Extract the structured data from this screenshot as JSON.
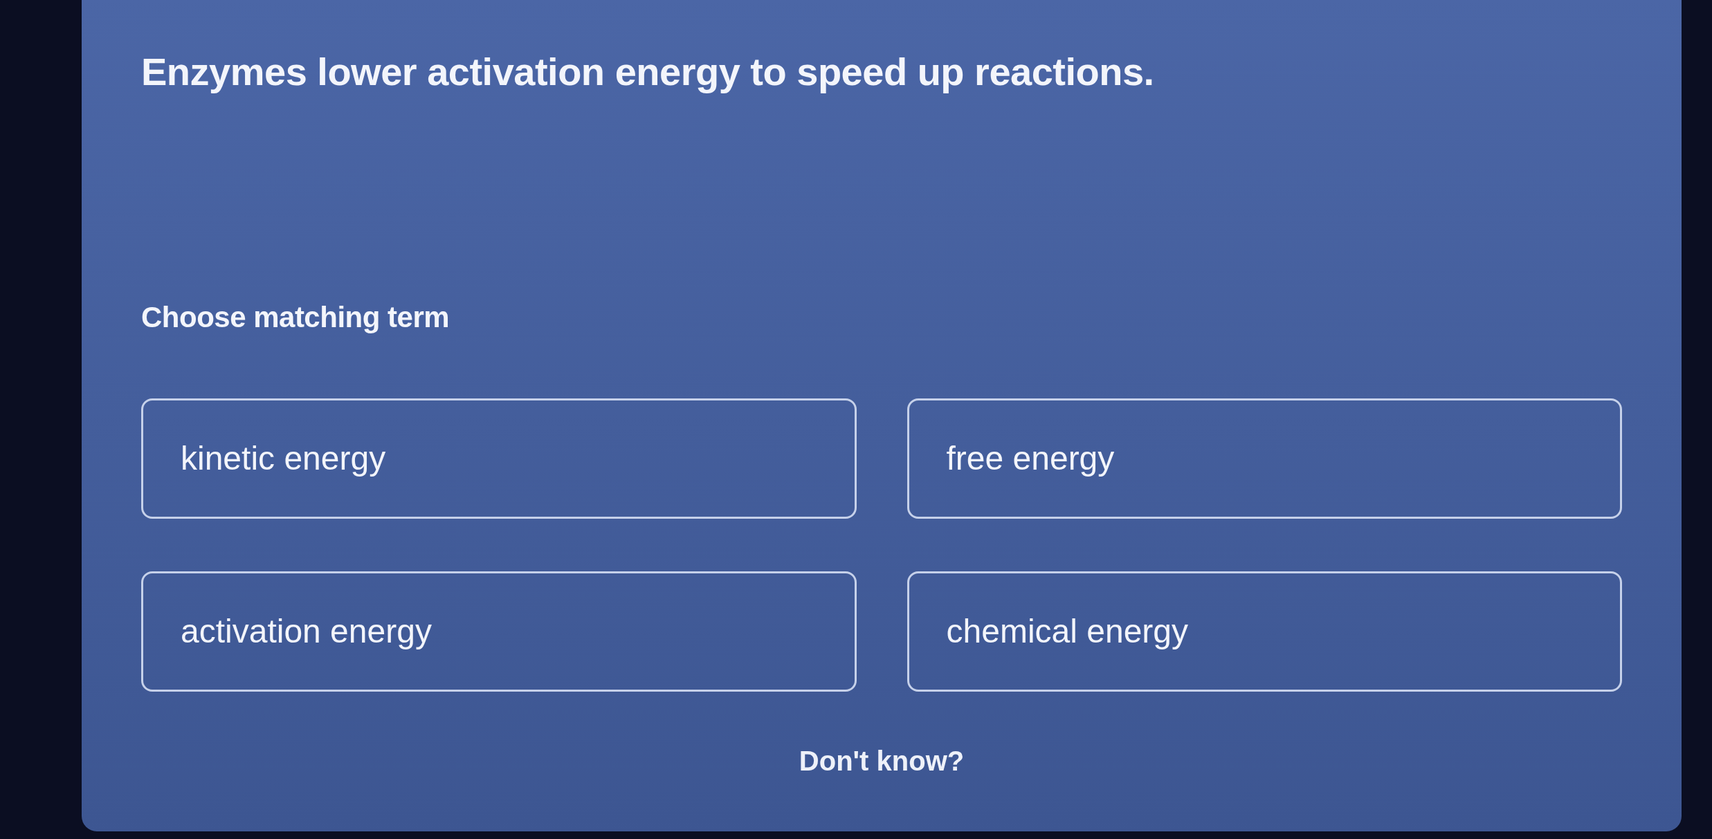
{
  "question": {
    "text": "Enzymes lower activation energy to speed up reactions."
  },
  "instruction": "Choose matching term",
  "options": [
    {
      "label": "kinetic energy",
      "selected": false
    },
    {
      "label": "free energy",
      "selected": false
    },
    {
      "label": "activation energy",
      "selected": false
    },
    {
      "label": "chemical energy",
      "selected": false
    }
  ],
  "dont_know": "Don't know?"
}
